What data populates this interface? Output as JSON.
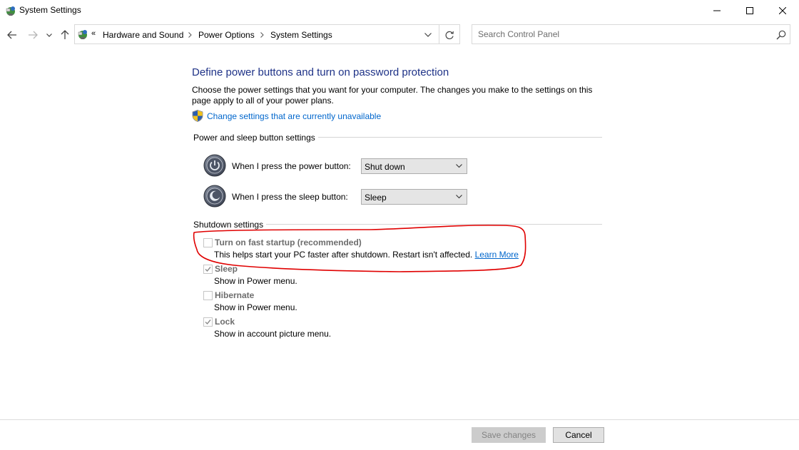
{
  "window": {
    "title": "System Settings",
    "icon": "control-panel-icon"
  },
  "nav": {
    "breadcrumb_overflow": "«",
    "breadcrumb": [
      "Hardware and Sound",
      "Power Options",
      "System Settings"
    ],
    "search_placeholder": "Search Control Panel"
  },
  "page": {
    "heading": "Define power buttons and turn on password protection",
    "description": "Choose the power settings that you want for your computer. The changes you make to the settings on this page apply to all of your power plans.",
    "change_link": "Change settings that are currently unavailable"
  },
  "power_section": {
    "label": "Power and sleep button settings",
    "rows": [
      {
        "label": "When I press the power button:",
        "value": "Shut down",
        "icon": "power-icon"
      },
      {
        "label": "When I press the sleep button:",
        "value": "Sleep",
        "icon": "sleep-moon-icon"
      }
    ]
  },
  "shutdown_section": {
    "label": "Shutdown settings",
    "options": [
      {
        "title": "Turn on fast startup (recommended)",
        "desc": "This helps start your PC faster after shutdown. Restart isn't affected.",
        "link": "Learn More",
        "checked": false
      },
      {
        "title": "Sleep",
        "desc": "Show in Power menu.",
        "checked": true
      },
      {
        "title": "Hibernate",
        "desc": "Show in Power menu.",
        "checked": false
      },
      {
        "title": "Lock",
        "desc": "Show in account picture menu.",
        "checked": true
      }
    ]
  },
  "footer": {
    "save_label": "Save changes",
    "cancel_label": "Cancel"
  },
  "colors": {
    "heading": "#1e3287",
    "link": "#0066cc",
    "annotation": "#e00000",
    "disabled_text": "#6d6d6d"
  }
}
